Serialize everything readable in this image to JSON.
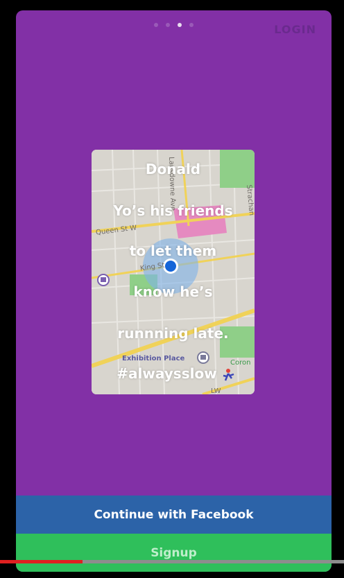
{
  "pager": {
    "count": 4,
    "active_index": 2
  },
  "header": {
    "login_label": "LOGIN"
  },
  "card": {
    "lines": [
      "Donald",
      "Yo’s his friends",
      "to let them",
      "know he’s",
      "runnning late.",
      "#alwaysslow"
    ],
    "map_labels": {
      "queen": "Queen St W",
      "king": "King St",
      "exhibition": "Exhibition Place",
      "ave": "Lansdowne Ave",
      "strachan": "Strachan",
      "coro": "Coron",
      "lw": "LW"
    }
  },
  "actions": {
    "facebook_label": "Continue with Facebook",
    "signup_label": "Signup"
  },
  "video": {
    "progress": 0.24
  },
  "colors": {
    "background": "#8230a6",
    "facebook": "#2c63a8",
    "signup": "#2fbf5b",
    "location_dot": "#1565d8"
  }
}
